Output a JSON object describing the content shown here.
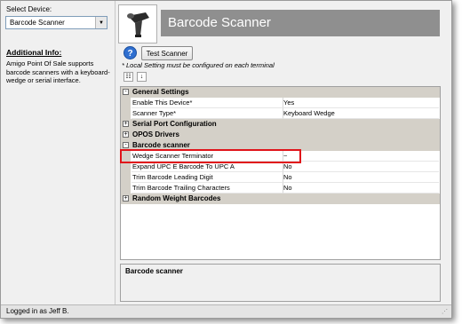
{
  "left_panel": {
    "select_label": "Select Device:",
    "device_value": "Barcode Scanner",
    "additional_heading": "Additional Info:",
    "additional_text": "Amigo Point Of Sale supports barcode scanners with a keyboard-wedge or serial interface."
  },
  "header": {
    "title": "Barcode Scanner"
  },
  "toolbar": {
    "help_glyph": "?",
    "test_button": "Test Scanner",
    "note": "* Local Setting must be configured on each terminal"
  },
  "grid": {
    "general_settings": "General Settings",
    "enable_device_name": "Enable This Device*",
    "enable_device_value": "Yes",
    "scanner_type_name": "Scanner Type*",
    "scanner_type_value": "Keyboard Wedge",
    "serial_port": "Serial Port Configuration",
    "opos": "OPOS Drivers",
    "barcode_scanner": "Barcode scanner",
    "terminator_name": "Wedge Scanner Terminator",
    "terminator_value": "~",
    "expand_upc_name": "Expand UPC E Barcode To UPC A",
    "expand_upc_value": "No",
    "trim_leading_name": "Trim Barcode Leading Digit",
    "trim_leading_value": "No",
    "trim_trailing_name": "Trim Barcode Trailing Characters",
    "trim_trailing_value": "No",
    "random_weight": "Random Weight Barcodes",
    "plus": "+",
    "minus": "-"
  },
  "description": {
    "title": "Barcode scanner"
  },
  "status": {
    "text": "Logged in as Jeff B."
  },
  "colors": {
    "highlight": "#e0141a",
    "banner": "#8f8f8f",
    "category": "#d4d0c8"
  }
}
